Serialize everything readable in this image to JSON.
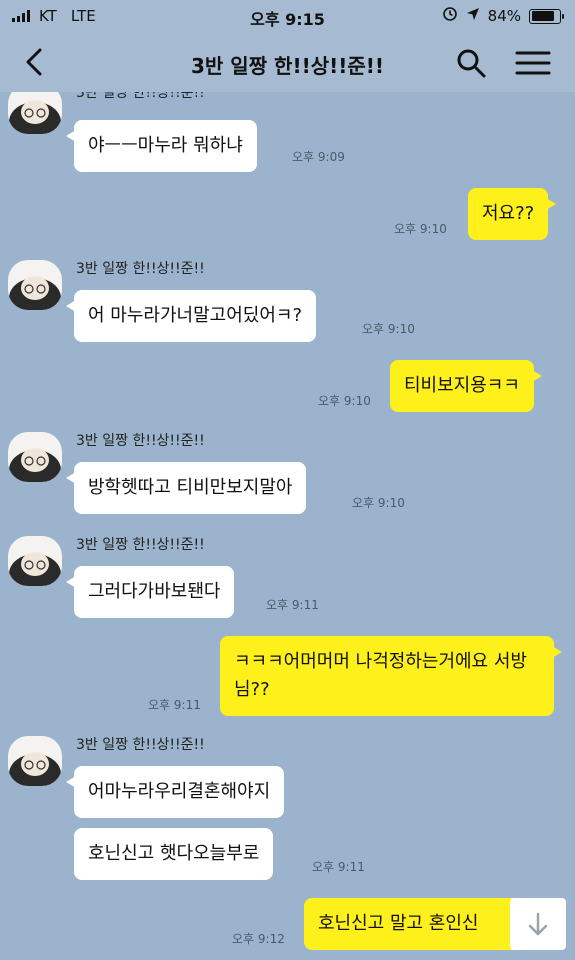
{
  "status_bar": {
    "carrier": "KT",
    "network": "LTE",
    "time": "오후 9:15",
    "battery": "84%",
    "battery_level": 0.84
  },
  "header": {
    "title": "3반 일짱 한!!상!!준!!",
    "back_icon": "chevron-left-icon",
    "search_icon": "search-icon",
    "menu_icon": "hamburger-menu-icon"
  },
  "colors": {
    "background": "#9bb3cc",
    "incoming_bubble": "#ffffff",
    "outgoing_bubble": "#fef01b"
  },
  "messages": [
    {
      "side": "in",
      "sender": "3반 일짱 한!!상!!준!!",
      "text": "야ㅡㅡ마누라 뭐하냐",
      "time": "오후 9:09"
    },
    {
      "side": "out",
      "text": "저요??",
      "time": "오후 9:10"
    },
    {
      "side": "in",
      "sender": "3반 일짱 한!!상!!준!!",
      "text": "어 마누라가너말고어딨어ㅋ?",
      "time": "오후 9:10"
    },
    {
      "side": "out",
      "text": "티비보지용ㅋㅋ",
      "time": "오후 9:10"
    },
    {
      "side": "in",
      "sender": "3반 일짱 한!!상!!준!!",
      "text": "방학헷따고 티비만보지말아",
      "time": "오후 9:10"
    },
    {
      "side": "in",
      "sender": "3반 일짱 한!!상!!준!!",
      "text": "그러다가바보됀다",
      "time": "오후 9:11"
    },
    {
      "side": "out",
      "text": "ㅋㅋㅋ어머머머 나걱정하는거에요 서방님??",
      "time": "오후 9:11"
    },
    {
      "side": "in",
      "sender": "3반 일짱 한!!상!!준!!",
      "text": "어마누라우리결혼해야지",
      "time": ""
    },
    {
      "side": "in",
      "text": "호닌신고 햇다오늘부로",
      "time": "오후 9:11"
    },
    {
      "side": "out",
      "text": "호닌신고 말고 혼인신",
      "time": "오후 9:12"
    }
  ],
  "scroll_down_icon": "arrow-down-icon"
}
